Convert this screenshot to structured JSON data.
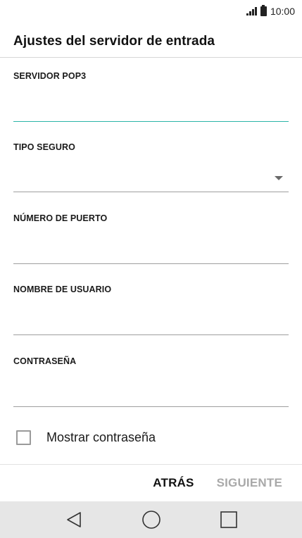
{
  "status_bar": {
    "time": "10:00",
    "icons": [
      "signal-icon",
      "battery-icon"
    ]
  },
  "header": {
    "title": "Ajustes del servidor de entrada"
  },
  "form": {
    "fields": [
      {
        "label": "SERVIDOR POP3",
        "value": "",
        "type": "text"
      },
      {
        "label": "TIPO SEGURO",
        "value": "",
        "type": "select"
      },
      {
        "label": "NÚMERO DE PUERTO",
        "value": "",
        "type": "text"
      },
      {
        "label": "NOMBRE DE USUARIO",
        "value": "",
        "type": "text"
      },
      {
        "label": "CONTRASEÑA",
        "value": "",
        "type": "password"
      }
    ],
    "show_password": {
      "label": "Mostrar contraseña",
      "checked": false
    }
  },
  "actions": {
    "back_label": "ATRÁS",
    "next_label": "SIGUIENTE"
  },
  "nav_bar": {
    "icons": [
      "back-icon",
      "home-icon",
      "recents-icon"
    ]
  },
  "colors": {
    "accent": "#2bb5a8",
    "disabled": "#a9a9a9",
    "nav_bg": "#e6e6e6"
  }
}
